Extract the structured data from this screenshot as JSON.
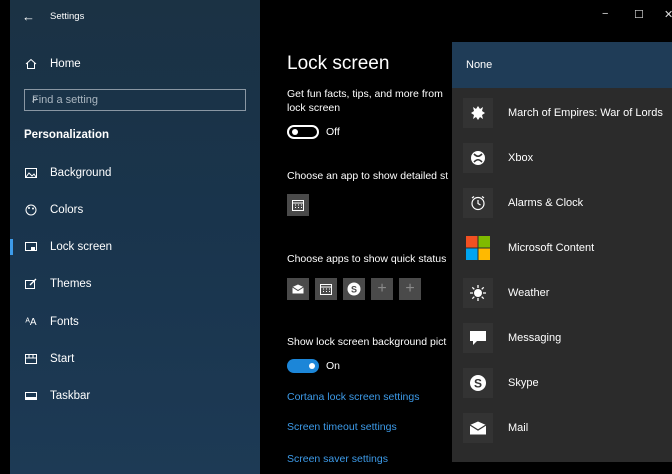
{
  "window": {
    "title": "Settings",
    "back_glyph": "←",
    "controls": {
      "minimize": "−",
      "maximize": "☐",
      "close": "✕"
    }
  },
  "sidebar": {
    "home_label": "Home",
    "search_placeholder": "Find a setting",
    "section_label": "Personalization",
    "items": [
      {
        "label": "Background",
        "icon": "image-icon",
        "glyph": "🖼"
      },
      {
        "label": "Colors",
        "icon": "palette-icon",
        "glyph": "🎨"
      },
      {
        "label": "Lock screen",
        "icon": "lock-screen-icon",
        "glyph": "⌐"
      },
      {
        "label": "Themes",
        "icon": "brush-icon",
        "glyph": "✎"
      },
      {
        "label": "Fonts",
        "icon": "fonts-icon",
        "glyph": "ᴬA"
      },
      {
        "label": "Start",
        "icon": "start-icon",
        "glyph": "☷"
      },
      {
        "label": "Taskbar",
        "icon": "taskbar-icon",
        "glyph": "▭"
      }
    ]
  },
  "main": {
    "title": "Lock screen",
    "fun_facts_text_line1": "Get fun facts, tips, and more from",
    "fun_facts_text_line2": "lock screen",
    "fun_facts_toggle": "Off",
    "detailed_status_label": "Choose an app to show detailed st",
    "quick_status_label": "Choose apps to show quick status",
    "bg_picture_label": "Show lock screen background pict",
    "bg_picture_toggle": "On",
    "links": [
      "Cortana lock screen settings",
      "Screen timeout settings",
      "Screen saver settings"
    ]
  },
  "flyout": {
    "none_label": "None",
    "items": [
      {
        "label": "March of Empires: War of Lords",
        "icon": "march-of-empires-icon"
      },
      {
        "label": "Xbox",
        "icon": "xbox-icon"
      },
      {
        "label": "Alarms & Clock",
        "icon": "alarm-clock-icon"
      },
      {
        "label": "Microsoft Content",
        "icon": "microsoft-logo-icon"
      },
      {
        "label": "Weather",
        "icon": "sun-icon"
      },
      {
        "label": "Messaging",
        "icon": "message-bubble-icon"
      },
      {
        "label": "Skype",
        "icon": "skype-icon"
      },
      {
        "label": "Mail",
        "icon": "mail-icon"
      }
    ]
  },
  "colors": {
    "accent": "#3d9be9",
    "toggle_on": "#1c86d8",
    "flyout_header": "#1f3c57"
  }
}
